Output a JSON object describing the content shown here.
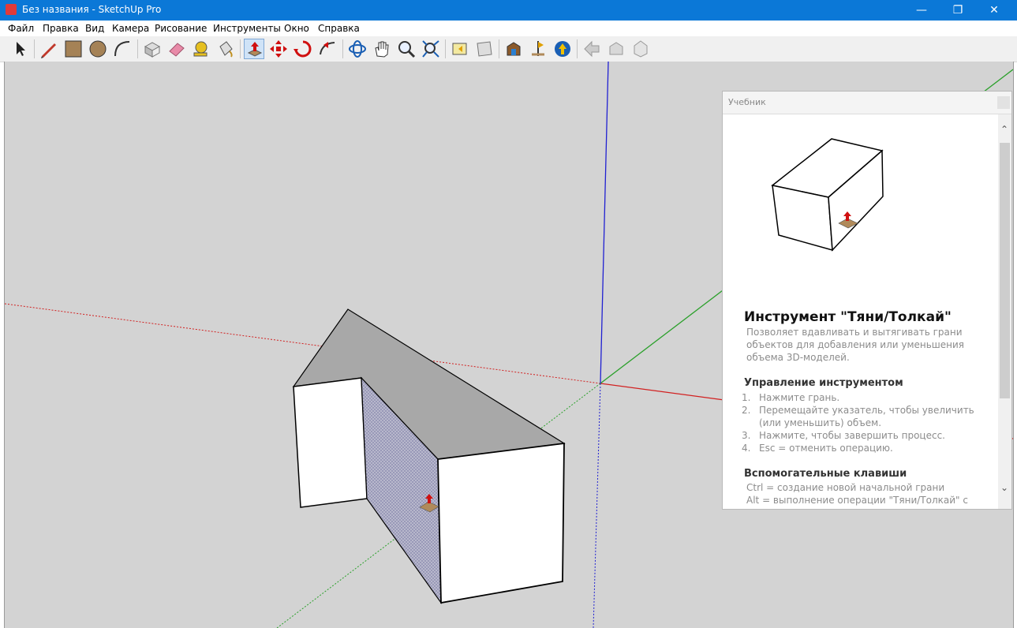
{
  "window": {
    "title": "Без названия - SketchUp Pro",
    "controls": [
      "minimize-icon",
      "restore-icon",
      "close-icon"
    ]
  },
  "menu": [
    "Файл",
    "Правка",
    "Вид",
    "Камера",
    "Рисование",
    "Инструменты",
    "Окно",
    "Справка"
  ],
  "toolbar": {
    "tools": [
      {
        "name": "select-tool",
        "icon": "arrow-cursor-icon"
      },
      {
        "name": "line-tool",
        "icon": "pencil-icon"
      },
      {
        "name": "rectangle-tool",
        "icon": "rectangle-icon"
      },
      {
        "name": "circle-tool",
        "icon": "circle-icon"
      },
      {
        "name": "arc-tool",
        "icon": "arc-icon"
      },
      {
        "name": "make-component-tool",
        "icon": "component-icon"
      },
      {
        "name": "eraser-tool",
        "icon": "eraser-icon"
      },
      {
        "name": "tape-measure-tool",
        "icon": "tape-measure-icon"
      },
      {
        "name": "paint-bucket-tool",
        "icon": "paint-bucket-icon"
      },
      {
        "name": "push-pull-tool",
        "icon": "push-pull-icon",
        "active": true
      },
      {
        "name": "move-tool",
        "icon": "move-icon"
      },
      {
        "name": "rotate-tool",
        "icon": "rotate-icon"
      },
      {
        "name": "follow-me-tool",
        "icon": "follow-me-icon"
      },
      {
        "name": "orbit-tool",
        "icon": "orbit-icon"
      },
      {
        "name": "pan-tool",
        "icon": "hand-icon"
      },
      {
        "name": "zoom-tool",
        "icon": "magnifier-icon"
      },
      {
        "name": "zoom-extents-tool",
        "icon": "zoom-extents-icon"
      },
      {
        "name": "previous-view-tool",
        "icon": "previous-view-icon"
      },
      {
        "name": "next-view-tool",
        "icon": "next-view-icon"
      },
      {
        "name": "3d-warehouse-tool",
        "icon": "warehouse-icon"
      },
      {
        "name": "add-location-tool",
        "icon": "location-icon"
      },
      {
        "name": "extension-warehouse-tool",
        "icon": "extension-warehouse-icon"
      },
      {
        "name": "share-model-tool",
        "icon": "share-model-icon"
      },
      {
        "name": "get-models-tool",
        "icon": "get-models-icon"
      },
      {
        "name": "share-component-tool",
        "icon": "share-component-icon"
      }
    ]
  },
  "colors": {
    "titlebar": "#0b78d7",
    "viewport": "#d3d3d3",
    "axis_red": "#d22020",
    "axis_green": "#2aa02a",
    "axis_blue": "#2020d2",
    "roof": "#a8a8a8",
    "selected_face": "#b4b4cc"
  },
  "tutorial": {
    "panel_title": "Учебник",
    "heading": "Инструмент \"Тяни/Толкай\"",
    "description": "Позволяет вдавливать и вытягивать грани объектов для добавления или уменьшения объема 3D-моделей.",
    "controls_heading": "Управление инструментом",
    "steps": [
      {
        "n": "1.",
        "text": "Нажмите грань."
      },
      {
        "n": "2.",
        "text": "Перемещайте указатель, чтобы увеличить (или уменьшить) объем."
      },
      {
        "n": "3.",
        "text": "Нажмите, чтобы завершить процесс."
      },
      {
        "n": "4.",
        "text": "Esc = отменить операцию."
      }
    ],
    "modifier_heading": "Вспомогательные клавиши",
    "modifiers": [
      "Ctrl = создание новой начальной грани",
      "Alt = выполнение операции \"Тяни/Толкай\" с"
    ]
  }
}
